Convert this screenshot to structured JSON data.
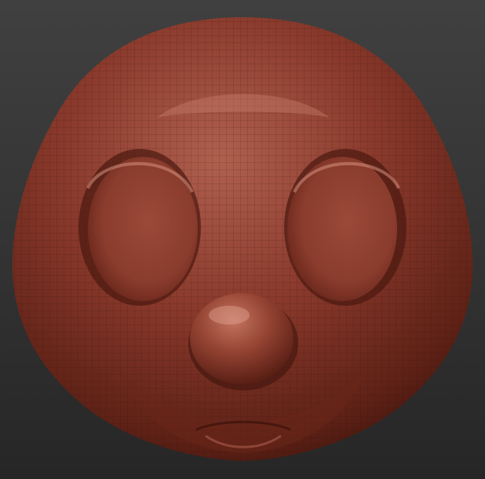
{
  "viewport": {
    "subject": "head-sculpt",
    "colors": {
      "background_top": "#404040",
      "background_bottom": "#262626",
      "clay_base": "#8a3a2c",
      "clay_highlight": "#c97a68",
      "clay_shadow": "#3e140d",
      "wireframe": "#2e0e08"
    }
  }
}
